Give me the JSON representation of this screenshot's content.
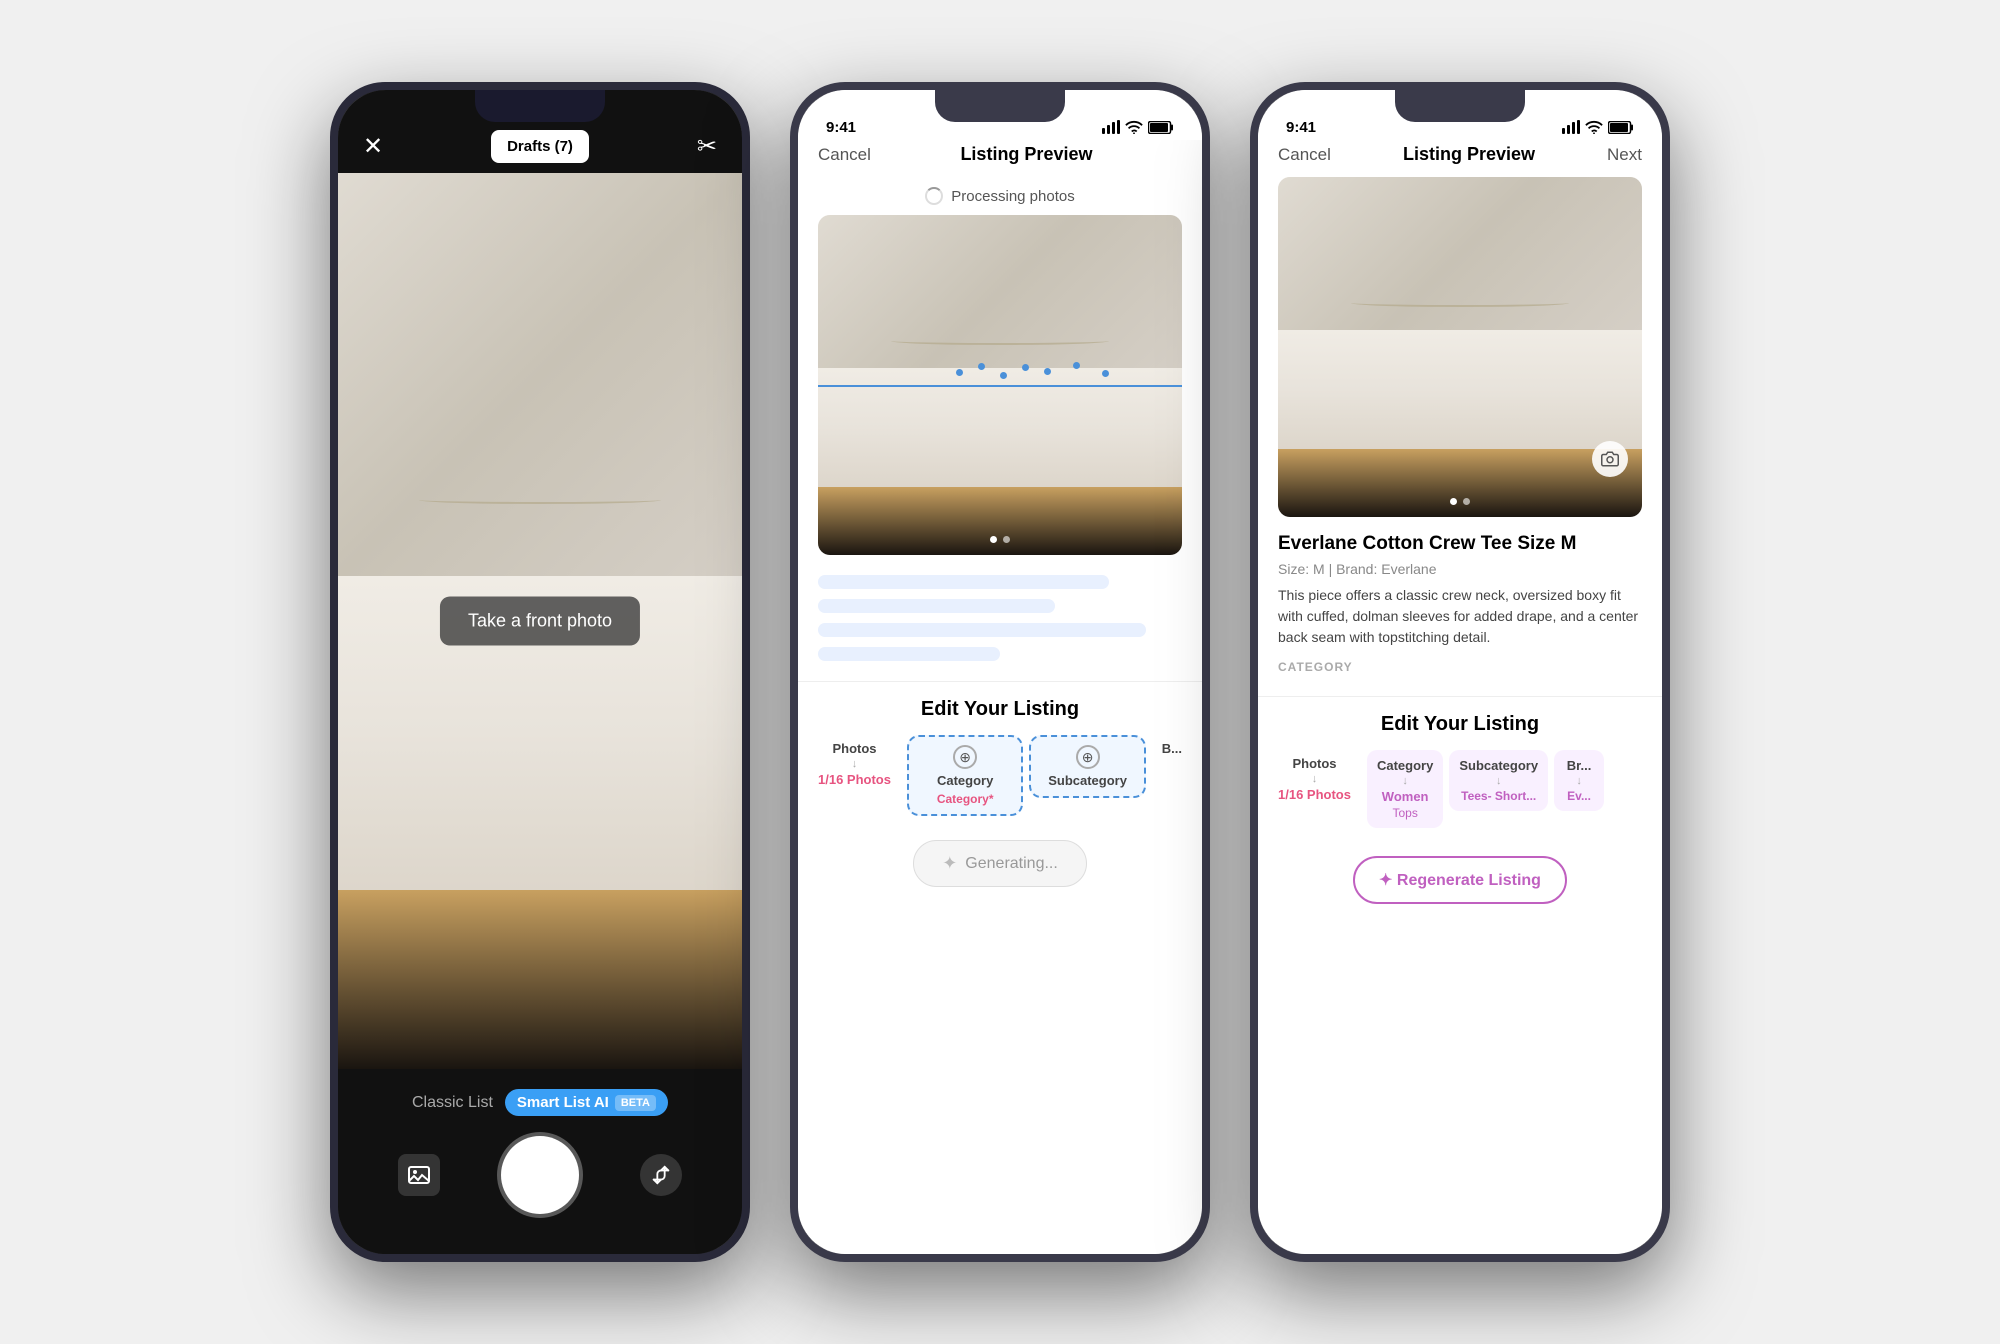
{
  "phone1": {
    "topBar": {
      "closeLabel": "✕",
      "draftsLabel": "Drafts (7)",
      "scissorsLabel": "✂"
    },
    "cameraPrompt": "Take a front photo",
    "bottomBar": {
      "classicLabel": "Classic List",
      "smartLabel": "Smart List AI",
      "betaLabel": "BETA"
    }
  },
  "phone2": {
    "statusBar": {
      "time": "9:41"
    },
    "navBar": {
      "cancelLabel": "Cancel",
      "titleLabel": "Listing Preview",
      "nextLabel": ""
    },
    "processingLabel": "Processing photos",
    "carouselDots": [
      "active",
      "inactive"
    ],
    "editSection": {
      "title": "Edit Your Listing",
      "tabs": [
        {
          "label": "Photos",
          "sublabel": "1/16 Photos",
          "icon": "↓"
        },
        {
          "label": "Category",
          "sublabel": "Category*",
          "icon": "⊕",
          "active": true
        },
        {
          "label": "Subcategory",
          "sublabel": "Subcategory",
          "icon": "⊕",
          "active": true
        }
      ]
    },
    "generatingLabel": "Generating..."
  },
  "phone3": {
    "statusBar": {
      "time": "9:41"
    },
    "navBar": {
      "cancelLabel": "Cancel",
      "titleLabel": "Listing Preview",
      "nextLabel": "Next"
    },
    "product": {
      "title": "Everlane Cotton Crew Tee Size M",
      "meta": "Size: M  |  Brand: Everlane",
      "description": "This piece offers a classic crew neck, oversized boxy fit with cuffed, dolman sleeves for added drape, and a center back seam with topstitching detail.",
      "categoryLabel": "CATEGORY"
    },
    "editSection": {
      "title": "Edit Your Listing",
      "tabs": [
        {
          "label": "Photos",
          "sublabel": "1/16 Photos",
          "icon": "↓"
        },
        {
          "label": "Category",
          "value": "Women",
          "sublabel": "Tops",
          "icon": "↓"
        },
        {
          "label": "Subcategory",
          "value": "Tees- Short...",
          "icon": "↓"
        },
        {
          "label": "Br...",
          "value": "Ev...",
          "icon": "↓"
        }
      ]
    },
    "regenerateLabel": "✦ Regenerate Listing"
  }
}
